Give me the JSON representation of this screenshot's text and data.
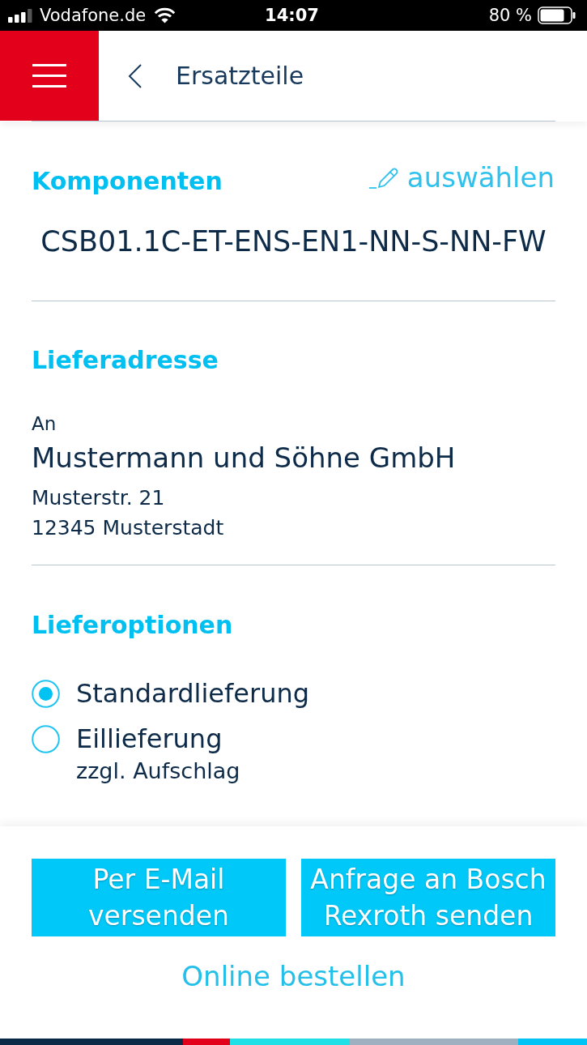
{
  "status_bar": {
    "carrier": "Vodafone.de",
    "time": "14:07",
    "battery": "80 %"
  },
  "header": {
    "title": "Ersatzteile"
  },
  "sections": [
    {
      "kind": "component",
      "title": "Komponenten",
      "action": "auswählen",
      "value": "CSB01.1C-ET-ENS-EN1-NN-S-NN-FW"
    },
    {
      "kind": "address",
      "title": "Lieferadresse",
      "salutation": "An",
      "name": "Mustermann und Söhne GmbH",
      "lines": [
        "Musterstr. 21",
        "12345 Musterstadt"
      ]
    },
    {
      "kind": "options",
      "title": "Lieferoptionen",
      "options": [
        {
          "label": "Standardlieferung",
          "selected": true
        },
        {
          "label": "Eillieferung",
          "note": "zzgl. Aufschlag",
          "selected": false
        }
      ]
    }
  ],
  "actions": {
    "buttons": [
      "Per E-Mail versenden",
      "Anfrage an Bosch Rexroth senden"
    ],
    "link": "Online bestellen"
  }
}
